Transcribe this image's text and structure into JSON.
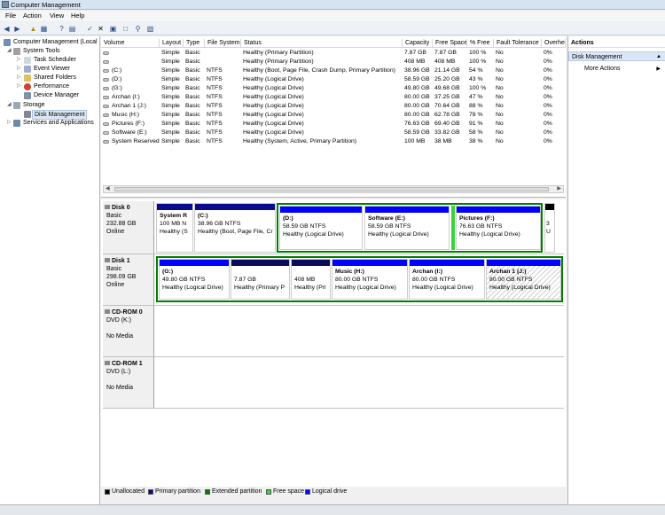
{
  "window": {
    "title": "Computer Management"
  },
  "menu": [
    "File",
    "Action",
    "View",
    "Help"
  ],
  "tree": {
    "root": "Computer Management (Local",
    "system_tools": "System Tools",
    "task_scheduler": "Task Scheduler",
    "event_viewer": "Event Viewer",
    "shared_folders": "Shared Folders",
    "performance": "Performance",
    "device_manager": "Device Manager",
    "storage": "Storage",
    "disk_management": "Disk Management",
    "services": "Services and Applications"
  },
  "volumes": {
    "columns": [
      "Volume",
      "Layout",
      "Type",
      "File System",
      "Status",
      "Capacity",
      "Free Space",
      "% Free",
      "Fault Tolerance",
      "Overhe"
    ],
    "rows": [
      [
        "",
        "Simple",
        "Basic",
        "",
        "Healthy (Primary Partition)",
        "7.87 GB",
        "7.87 GB",
        "100 %",
        "No",
        "0%"
      ],
      [
        "",
        "Simple",
        "Basic",
        "",
        "Healthy (Primary Partition)",
        "408 MB",
        "408 MB",
        "100 %",
        "No",
        "0%"
      ],
      [
        "(C:)",
        "Simple",
        "Basic",
        "NTFS",
        "Healthy (Boot, Page File, Crash Dump, Primary Partition)",
        "38.96 GB",
        "21.14 GB",
        "54 %",
        "No",
        "0%"
      ],
      [
        "(D:)",
        "Simple",
        "Basic",
        "NTFS",
        "Healthy (Logical Drive)",
        "58.59 GB",
        "25.20 GB",
        "43 %",
        "No",
        "0%"
      ],
      [
        "(G:)",
        "Simple",
        "Basic",
        "NTFS",
        "Healthy (Logical Drive)",
        "49.80 GB",
        "49.68 GB",
        "100 %",
        "No",
        "0%"
      ],
      [
        "Archan (I:)",
        "Simple",
        "Basic",
        "NTFS",
        "Healthy (Logical Drive)",
        "80.00 GB",
        "37.25 GB",
        "47 %",
        "No",
        "0%"
      ],
      [
        "Archan 1 (J:)",
        "Simple",
        "Basic",
        "NTFS",
        "Healthy (Logical Drive)",
        "80.00 GB",
        "70.64 GB",
        "88 %",
        "No",
        "0%"
      ],
      [
        "Music (H:)",
        "Simple",
        "Basic",
        "NTFS",
        "Healthy (Logical Drive)",
        "80.00 GB",
        "62.78 GB",
        "78 %",
        "No",
        "0%"
      ],
      [
        "Pictures (F:)",
        "Simple",
        "Basic",
        "NTFS",
        "Healthy (Logical Drive)",
        "76.63 GB",
        "69.40 GB",
        "91 %",
        "No",
        "0%"
      ],
      [
        "Software (E:)",
        "Simple",
        "Basic",
        "NTFS",
        "Healthy (Logical Drive)",
        "58.59 GB",
        "33.82 GB",
        "58 %",
        "No",
        "0%"
      ],
      [
        "System Reserved",
        "Simple",
        "Basic",
        "NTFS",
        "Healthy (System, Active, Primary Partition)",
        "100 MB",
        "38 MB",
        "38 %",
        "No",
        "0%"
      ]
    ]
  },
  "disks": {
    "disk0": {
      "name": "Disk 0",
      "type": "Basic",
      "size": "232.88 GB",
      "state": "Online",
      "p1": {
        "name": "System R",
        "size": "100 MB N",
        "status": "Healthy (S"
      },
      "p2": {
        "name": "(C:)",
        "size": "38.96 GB NTFS",
        "status": "Healthy (Boot, Page File, Cr"
      },
      "p3": {
        "name": "(D:)",
        "size": "58.59 GB NTFS",
        "status": "Healthy (Logical Drive)"
      },
      "p4": {
        "name": "Software  (E:)",
        "size": "58.59 GB NTFS",
        "status": "Healthy (Logical Drive)"
      },
      "p5": {
        "name": "Pictures  (F:)",
        "size": "76.63 GB NTFS",
        "status": "Healthy (Logical Drive)"
      },
      "p6": {
        "size": "3",
        "status": "U"
      }
    },
    "disk1": {
      "name": "Disk 1",
      "type": "Basic",
      "size": "298.09 GB",
      "state": "Online",
      "p1": {
        "name": "(G:)",
        "size": "49.80 GB NTFS",
        "status": "Healthy (Logical Drive)"
      },
      "p2": {
        "size": "7.87 GB",
        "status": "Healthy (Primary P"
      },
      "p3": {
        "size": "408 MB",
        "status": "Healthy (Pri"
      },
      "p4": {
        "name": "Music  (H:)",
        "size": "80.00 GB NTFS",
        "status": "Healthy (Logical Drive)"
      },
      "p5": {
        "name": "Archan  (I:)",
        "size": "80.00 GB NTFS",
        "status": "Healthy (Logical Drive)"
      },
      "p6": {
        "name": "Archan 1  (J:)",
        "size": "80.00 GB NTFS",
        "status": "Healthy (Logical Drive)"
      }
    },
    "cd0": {
      "name": "CD-ROM 0",
      "type": "DVD (K:)",
      "state": "No Media"
    },
    "cd1": {
      "name": "CD-ROM 1",
      "type": "DVD (L:)",
      "state": "No Media"
    }
  },
  "legend": [
    "Unallocated",
    "Primary partition",
    "Extended partition",
    "Free space",
    "Logical drive"
  ],
  "colors": {
    "unallocated": "#000000",
    "primary": "#0a0a8f",
    "extended": "#008000",
    "free": "#38d438",
    "logical": "#0000ff"
  },
  "actions": {
    "header": "Actions",
    "section": "Disk Management",
    "more": "More Actions"
  }
}
